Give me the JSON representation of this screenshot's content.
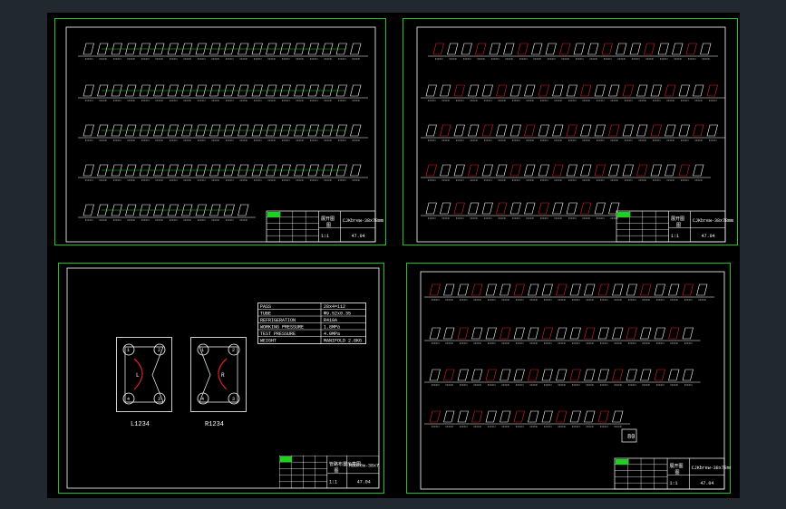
{
  "title_blocks": {
    "sheet1": {
      "name": "展开图",
      "code": "图",
      "right": "CJKbrew-38x78mm",
      "scale": "1:1",
      "sheet": "47.04"
    },
    "sheet2": {
      "name": "展开图",
      "code": "图",
      "right": "CJKbrew-38x78mm",
      "scale": "1:1",
      "sheet": "47.04"
    },
    "sheet3": {
      "name": "管路布置示意图",
      "code": "图",
      "right": "Mbbrew-38x78mm",
      "scale": "1:1",
      "sheet": "47.04"
    },
    "sheet4": {
      "name": "展开图",
      "code": "图",
      "right": "CJKbrew-38x78mm",
      "scale": "1:1",
      "sheet": "47.04"
    }
  },
  "spec_table": {
    "rows": [
      {
        "key": "PASS",
        "value": "28x4=112"
      },
      {
        "key": "TUBE",
        "value": "Φ9.52x0.35"
      },
      {
        "key": "REFRIGERATION",
        "value": "R410A"
      },
      {
        "key": "WORKING PRESSURE",
        "value": "1.8MPa"
      },
      {
        "key": "TEST PRESSURE",
        "value": "4.0MPa"
      },
      {
        "key": "WEIGHT",
        "value": "MANIFOLD 2.8KG"
      }
    ]
  },
  "port_diagrams": [
    {
      "letter": "L",
      "caption": "L1234",
      "ports": [
        "1",
        "2",
        "4",
        "3"
      ]
    },
    {
      "letter": "R",
      "caption": "R1234",
      "ports": [
        "1",
        "2",
        "4",
        "3"
      ]
    }
  ],
  "sheet_tags": {
    "in": "IN",
    "out": "OUT",
    "big": "80"
  },
  "colors": {
    "sheet_border": "#1ec31e",
    "line": "#ffffff",
    "accent_red": "#e02020",
    "accent_green": "#20d020"
  }
}
